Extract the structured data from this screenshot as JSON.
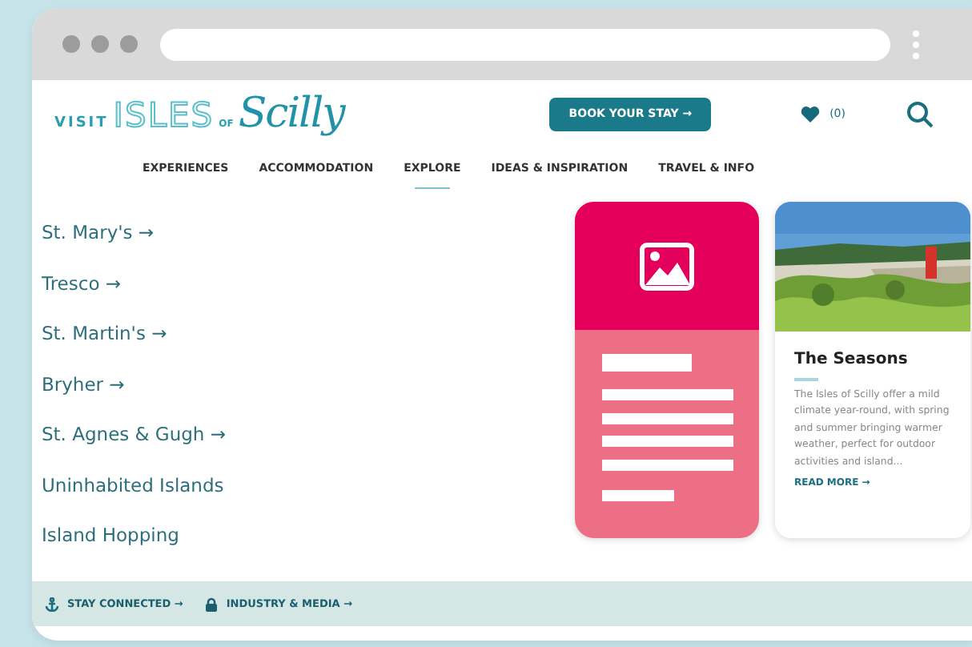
{
  "logo": {
    "visit": "VISIT",
    "isles": "ISLES",
    "of": "OF",
    "scilly": "Scilly"
  },
  "header": {
    "book_button": "BOOK YOUR STAY →",
    "favourites_count": "(0)"
  },
  "nav": [
    {
      "label": "EXPERIENCES",
      "selected": false
    },
    {
      "label": "ACCOMMODATION",
      "selected": false
    },
    {
      "label": "EXPLORE",
      "selected": true
    },
    {
      "label": "IDEAS & INSPIRATION",
      "selected": false
    },
    {
      "label": "TRAVEL & INFO",
      "selected": false
    }
  ],
  "islands": [
    "St. Mary's →",
    "Tresco →",
    "St. Martin's →",
    "Bryher →",
    "St. Agnes & Gugh →",
    "Uninhabited Islands",
    "Island Hopping"
  ],
  "cards": [
    {
      "kind": "placeholder"
    },
    {
      "kind": "article",
      "title": "The Seasons",
      "body": "The Isles of Scilly offer a mild climate year-round, with spring and summer bringing warmer weather, perfect for outdoor activities and island...",
      "link": "READ MORE →"
    }
  ],
  "footer": [
    {
      "kind": "anchor",
      "label": "STAY CONNECTED →"
    },
    {
      "kind": "lock",
      "label": "INDUSTRY & MEDIA →"
    }
  ]
}
